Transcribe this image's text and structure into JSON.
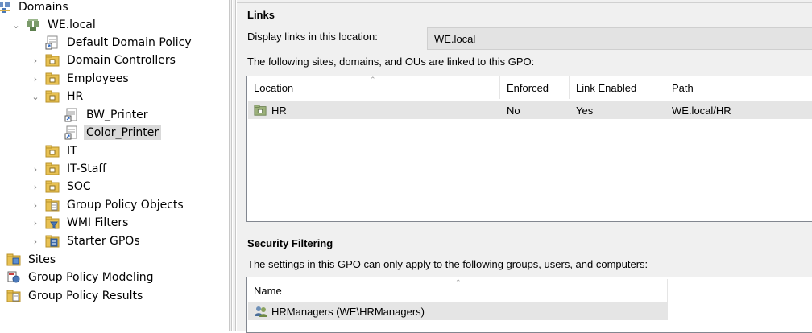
{
  "tree": {
    "items": [
      {
        "label": "Domains",
        "chevron": "",
        "icon": "domains-icon"
      },
      {
        "label": "WE.local",
        "chevron": "⌄",
        "icon": "domain-icon"
      },
      {
        "label": "Default Domain Policy",
        "chevron": "",
        "icon": "gpo-link-icon"
      },
      {
        "label": "Domain Controllers",
        "chevron": "›",
        "icon": "ou-icon"
      },
      {
        "label": "Employees",
        "chevron": "›",
        "icon": "ou-icon"
      },
      {
        "label": "HR",
        "chevron": "⌄",
        "icon": "ou-icon"
      },
      {
        "label": "BW_Printer",
        "chevron": "",
        "icon": "gpo-link-icon"
      },
      {
        "label": "Color_Printer",
        "chevron": "",
        "icon": "gpo-link-icon"
      },
      {
        "label": "IT",
        "chevron": "",
        "icon": "ou-icon"
      },
      {
        "label": "IT-Staff",
        "chevron": "›",
        "icon": "ou-icon"
      },
      {
        "label": "SOC",
        "chevron": "›",
        "icon": "ou-icon"
      },
      {
        "label": "Group Policy Objects",
        "chevron": "›",
        "icon": "gpo-folder-icon"
      },
      {
        "label": "WMI Filters",
        "chevron": "›",
        "icon": "wmi-folder-icon"
      },
      {
        "label": "Starter GPOs",
        "chevron": "›",
        "icon": "starter-folder-icon"
      },
      {
        "label": "Sites",
        "chevron": "",
        "icon": "sites-icon"
      },
      {
        "label": "Group Policy Modeling",
        "chevron": "",
        "icon": "modeling-icon"
      },
      {
        "label": "Group Policy Results",
        "chevron": "",
        "icon": "results-icon"
      }
    ],
    "selected": "Color_Printer"
  },
  "links": {
    "title": "Links",
    "display_label": "Display links in this location:",
    "location_value": "WE.local",
    "description": "The following sites, domains, and OUs are linked to this GPO:",
    "columns": [
      "Location",
      "Enforced",
      "Link Enabled",
      "Path"
    ],
    "rows": [
      {
        "location": "HR",
        "enforced": "No",
        "link_enabled": "Yes",
        "path": "WE.local/HR"
      }
    ]
  },
  "security": {
    "title": "Security Filtering",
    "description": "The settings in this GPO can only apply to the following groups, users, and computers:",
    "columns": [
      "Name"
    ],
    "rows": [
      {
        "name": "HRManagers (WE\\HRManagers)"
      }
    ]
  },
  "colors": {
    "folder": "#e8c153",
    "selection": "#d9d9d9",
    "pane_bg": "#f0f0f0"
  }
}
